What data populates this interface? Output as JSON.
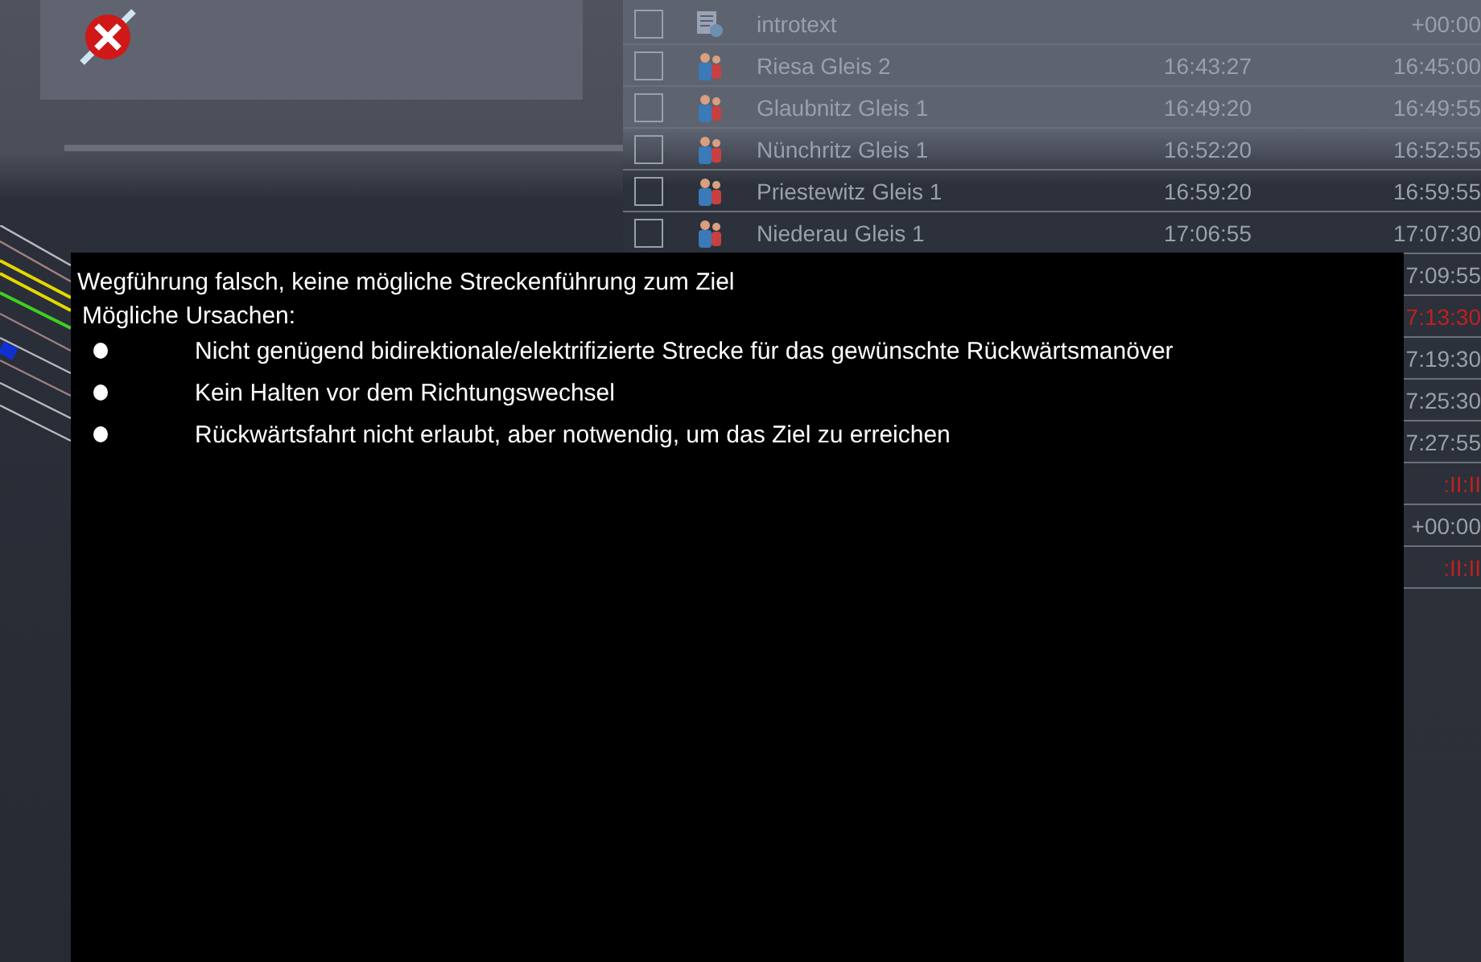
{
  "schedule": {
    "rows": [
      {
        "checked": false,
        "kind": "script",
        "name": "introtext",
        "departure": "+00:00",
        "late": false
      },
      {
        "checked": false,
        "kind": "passengers",
        "name": "Riesa Gleis 2",
        "arrival": "16:43:27",
        "departure": "16:45:00",
        "late": false
      },
      {
        "checked": false,
        "kind": "passengers",
        "name": "Glaubnitz Gleis 1",
        "arrival": "16:49:20",
        "departure": "16:49:55",
        "late": false
      },
      {
        "checked": false,
        "kind": "passengers",
        "name": "Nünchritz Gleis 1",
        "arrival": "16:52:20",
        "departure": "16:52:55",
        "late": false
      },
      {
        "checked": false,
        "kind": "passengers",
        "name": "Priestewitz Gleis 1",
        "arrival": "16:59:20",
        "departure": "16:59:55",
        "late": false
      },
      {
        "checked": false,
        "kind": "passengers",
        "name": "Niederau Gleis 1",
        "arrival": "17:06:55",
        "departure": "17:07:30",
        "late": false
      },
      {
        "departure": "7:09:55",
        "late": false
      },
      {
        "departure": "7:13:30",
        "late": true
      },
      {
        "departure": "7:19:30",
        "late": false
      },
      {
        "departure": "7:25:30",
        "late": false
      },
      {
        "departure": "7:27:55",
        "late": false
      },
      {
        "departure": ":II:II",
        "late": true
      },
      {
        "departure": "+00:00",
        "late": false
      },
      {
        "departure": ":II:II",
        "late": true
      }
    ]
  },
  "message": {
    "title": "Wegführung falsch, keine mögliche Streckenführung zum Ziel",
    "subtitle": "Mögliche Ursachen:",
    "causes": [
      "Nicht genügend bidirektionale/elektrifizierte Strecke für das gewünschte Rückwärtsmanöver",
      "Kein Halten vor dem Richtungswechsel",
      "Rückwärtsfahrt nicht erlaubt, aber notwendig, um das Ziel zu erreichen"
    ]
  }
}
